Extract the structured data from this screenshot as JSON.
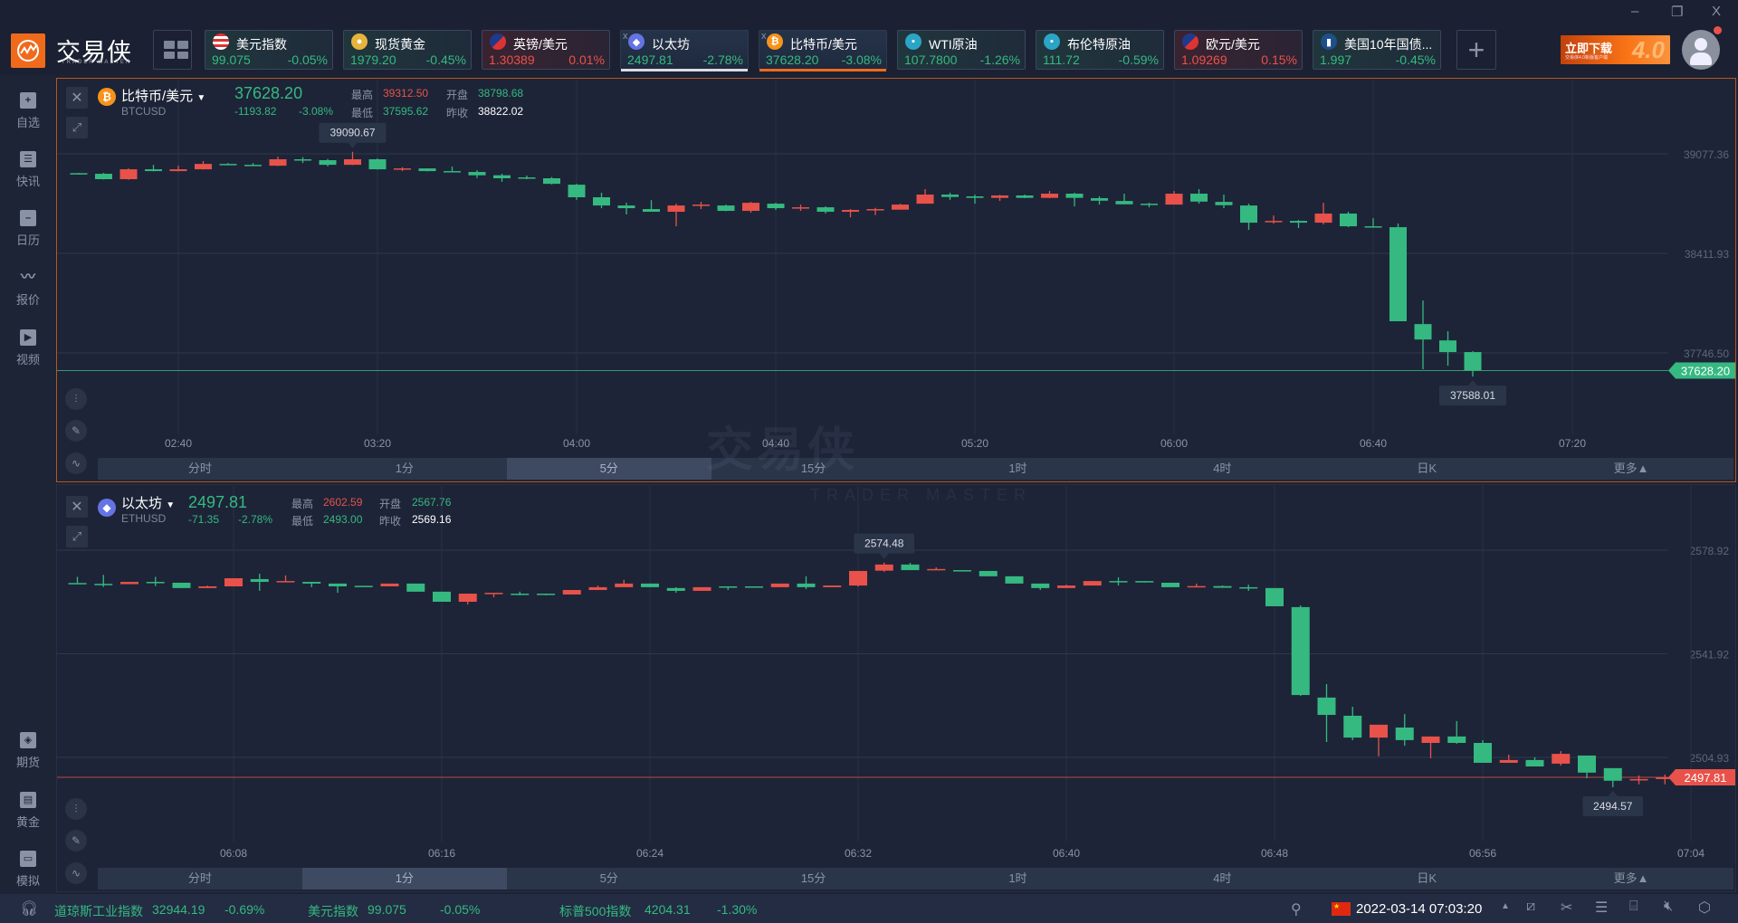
{
  "app": {
    "logo_text": "交易侠",
    "logo_sub": "TRADER MASTER",
    "banner_main": "立即下载",
    "banner_sub": "交易侠4.0新版客户端",
    "banner_version": "4.0",
    "window": {
      "minimize": "–",
      "restore": "❐",
      "close": "X"
    }
  },
  "tickers": [
    {
      "name": "美元指数",
      "price": "99.075",
      "change": "-0.05%",
      "dir": "down",
      "icon": "us-flag-icon"
    },
    {
      "name": "现货黄金",
      "price": "1979.20",
      "change": "-0.45%",
      "dir": "down",
      "icon": "gold-icon"
    },
    {
      "name": "英镑/美元",
      "price": "1.30389",
      "change": "0.01%",
      "dir": "up",
      "icon": "uk-us-flag-icon"
    },
    {
      "name": "以太坊",
      "price": "2497.81",
      "change": "-2.78%",
      "dir": "down",
      "icon": "ethereum-icon",
      "selected": true,
      "underline": "#d7dbe3"
    },
    {
      "name": "比特币/美元",
      "price": "37628.20",
      "change": "-3.08%",
      "dir": "down",
      "icon": "bitcoin-icon",
      "selected": true,
      "underline": "#f06a1c"
    },
    {
      "name": "WTI原油",
      "price": "107.7800",
      "change": "-1.26%",
      "dir": "down",
      "icon": "oil-icon"
    },
    {
      "name": "布伦特原油",
      "price": "111.72",
      "change": "-0.59%",
      "dir": "down",
      "icon": "oil-icon"
    },
    {
      "name": "欧元/美元",
      "price": "1.09269",
      "change": "0.15%",
      "dir": "up",
      "icon": "eu-us-flag-icon"
    },
    {
      "name": "美国10年国债...",
      "price": "1.997",
      "change": "-0.45%",
      "dir": "down",
      "icon": "bond-icon"
    }
  ],
  "sidebar": {
    "top": [
      {
        "label": "自选",
        "icon": "bookmark-icon"
      },
      {
        "label": "快讯",
        "icon": "news-icon"
      },
      {
        "label": "日历",
        "icon": "calendar-icon"
      },
      {
        "label": "报价",
        "icon": "quote-chart-icon"
      },
      {
        "label": "视频",
        "icon": "video-icon"
      }
    ],
    "bottom": [
      {
        "label": "期货",
        "icon": "futures-icon"
      },
      {
        "label": "黄金",
        "icon": "gold-bar-icon"
      },
      {
        "label": "模拟",
        "icon": "wallet-icon"
      }
    ]
  },
  "watermark": {
    "text": "交易侠",
    "sub": "TRADER MASTER"
  },
  "colors": {
    "up": "#e8524a",
    "down": "#35b981",
    "accent": "#f06a1c"
  },
  "panels": [
    {
      "title": "比特币/美元",
      "symbol": "BTCUSD",
      "price": "37628.20",
      "change": "-1193.82",
      "change_pct": "-3.08%",
      "high_label": "最高",
      "high": "39312.50",
      "open_label": "开盘",
      "open": "38798.68",
      "low_label": "最低",
      "low": "37595.62",
      "prev_label": "昨收",
      "prev": "38822.02",
      "tabs": [
        "分时",
        "1分",
        "5分",
        "15分",
        "1时",
        "4时",
        "日K",
        "更多▲"
      ],
      "active_tab": 2
    },
    {
      "title": "以太坊",
      "symbol": "ETHUSD",
      "price": "2497.81",
      "change": "-71.35",
      "change_pct": "-2.78%",
      "high_label": "最高",
      "high": "2602.59",
      "open_label": "开盘",
      "open": "2567.76",
      "low_label": "最低",
      "low": "2493.00",
      "prev_label": "昨收",
      "prev": "2569.16",
      "tabs": [
        "分时",
        "1分",
        "5分",
        "15分",
        "1时",
        "4时",
        "日K",
        "更多▲"
      ],
      "active_tab": 1
    }
  ],
  "chart_data": [
    {
      "type": "candlestick",
      "title": "BTCUSD 5分",
      "interval": "5m",
      "current": "37628.20",
      "current_dir": "down",
      "y_ticks": [
        {
          "value": 39077.36,
          "label": "39077.36"
        },
        {
          "value": 38411.93,
          "label": "38411.93"
        },
        {
          "value": 37746.5,
          "label": "37746.50"
        }
      ],
      "x_ticks": [
        "02:40",
        "03:20",
        "04:00",
        "04:40",
        "05:20",
        "06:00",
        "06:40",
        "07:20"
      ],
      "tooltips": [
        {
          "label": "39090.67",
          "candle": 11,
          "side": "above"
        },
        {
          "label": "37588.01",
          "candle": 56,
          "side": "below"
        }
      ],
      "ohlc": [
        [
          38948,
          38950,
          38946,
          38948
        ],
        [
          38944,
          38950,
          38906,
          38908
        ],
        [
          38908,
          38980,
          38904,
          38974
        ],
        [
          38974,
          39004,
          38960,
          38962
        ],
        [
          38962,
          38998,
          38960,
          38974
        ],
        [
          38974,
          39029,
          38972,
          39010
        ],
        [
          39010,
          39016,
          39002,
          39004
        ],
        [
          39004,
          39016,
          38996,
          38998
        ],
        [
          38998,
          39059,
          38996,
          39041
        ],
        [
          39041,
          39055,
          39016,
          39035
        ],
        [
          39035,
          39043,
          38994,
          39004
        ],
        [
          39004,
          39091,
          39002,
          39041
        ],
        [
          39041,
          39047,
          38972,
          38974
        ],
        [
          38974,
          38988,
          38962,
          38980
        ],
        [
          38980,
          38980,
          38960,
          38962
        ],
        [
          38962,
          38992,
          38956,
          38958
        ],
        [
          38956,
          38968,
          38916,
          38934
        ],
        [
          38934,
          38944,
          38891,
          38914
        ],
        [
          38920,
          38932,
          38908,
          38914
        ],
        [
          38914,
          38922,
          38873,
          38877
        ],
        [
          38871,
          38877,
          38770,
          38787
        ],
        [
          38787,
          38817,
          38714,
          38732
        ],
        [
          38732,
          38750,
          38672,
          38714
        ],
        [
          38708,
          38768,
          38690,
          38690
        ],
        [
          38690,
          38744,
          38593,
          38732
        ],
        [
          38732,
          38756,
          38708,
          38738
        ],
        [
          38732,
          38738,
          38694,
          38696
        ],
        [
          38696,
          38756,
          38684,
          38750
        ],
        [
          38744,
          38750,
          38702,
          38714
        ],
        [
          38714,
          38738,
          38696,
          38720
        ],
        [
          38720,
          38726,
          38678,
          38690
        ],
        [
          38690,
          38708,
          38653,
          38702
        ],
        [
          38706,
          38716,
          38668,
          38708
        ],
        [
          38704,
          38744,
          38704,
          38738
        ],
        [
          38744,
          38841,
          38744,
          38805
        ],
        [
          38805,
          38817,
          38770,
          38789
        ],
        [
          38793,
          38805,
          38744,
          38783
        ],
        [
          38783,
          38803,
          38762,
          38799
        ],
        [
          38799,
          38805,
          38781,
          38783
        ],
        [
          38783,
          38829,
          38781,
          38811
        ],
        [
          38811,
          38817,
          38726,
          38783
        ],
        [
          38781,
          38793,
          38738,
          38764
        ],
        [
          38762,
          38811,
          38740,
          38740
        ],
        [
          38744,
          38750,
          38720,
          38740
        ],
        [
          38738,
          38829,
          38738,
          38811
        ],
        [
          38811,
          38841,
          38744,
          38758
        ],
        [
          38756,
          38805,
          38714,
          38734
        ],
        [
          38732,
          38744,
          38569,
          38617
        ],
        [
          38623,
          38665,
          38611,
          38629
        ],
        [
          38629,
          38635,
          38581,
          38617
        ],
        [
          38617,
          38750,
          38605,
          38678
        ],
        [
          38678,
          38690,
          38587,
          38593
        ],
        [
          38593,
          38647,
          38589,
          38589
        ],
        [
          38587,
          38611,
          37958,
          37958
        ],
        [
          37939,
          38097,
          37637,
          37836
        ],
        [
          37830,
          37891,
          37661,
          37752
        ],
        [
          37752,
          37758,
          37588,
          37628.2
        ]
      ]
    },
    {
      "type": "candlestick",
      "title": "ETHUSD 1分",
      "interval": "1m",
      "current": "2497.81",
      "current_dir": "up",
      "y_ticks": [
        {
          "value": 2578.92,
          "label": "2578.92"
        },
        {
          "value": 2541.92,
          "label": "2541.92"
        },
        {
          "value": 2504.93,
          "label": "2504.93"
        }
      ],
      "x_ticks": [
        "06:08",
        "06:16",
        "06:24",
        "06:32",
        "06:40",
        "06:48",
        "06:56",
        "07:04"
      ],
      "tooltips": [
        {
          "label": "2574.48",
          "candle": 31,
          "side": "above"
        },
        {
          "label": "2494.57",
          "candle": 59,
          "side": "below"
        }
      ],
      "ohlc": [
        [
          2567.2,
          2569.4,
          2567.2,
          2567.2
        ],
        [
          2566.9,
          2570.1,
          2565.8,
          2566.9
        ],
        [
          2566.8,
          2567.6,
          2566.8,
          2567.6
        ],
        [
          2567.6,
          2569.4,
          2566.1,
          2567.5
        ],
        [
          2567.3,
          2567.3,
          2565.4,
          2565.4
        ],
        [
          2565.4,
          2566.3,
          2565.4,
          2566.0
        ],
        [
          2566.0,
          2568.9,
          2566.0,
          2568.9
        ],
        [
          2568.6,
          2570.5,
          2564.4,
          2567.6
        ],
        [
          2567.6,
          2569.9,
          2567.6,
          2567.9
        ],
        [
          2567.6,
          2567.6,
          2565.7,
          2567.0
        ],
        [
          2567.0,
          2567.0,
          2563.7,
          2566.0
        ],
        [
          2566.2,
          2566.2,
          2566.0,
          2566.0
        ],
        [
          2566.0,
          2567.0,
          2566.0,
          2567.0
        ],
        [
          2567.0,
          2567.0,
          2564.1,
          2564.1
        ],
        [
          2564.1,
          2564.1,
          2560.5,
          2560.5
        ],
        [
          2560.5,
          2563.4,
          2559.5,
          2563.4
        ],
        [
          2563.4,
          2563.7,
          2562.1,
          2563.7
        ],
        [
          2563.4,
          2564.1,
          2562.8,
          2563.1
        ],
        [
          2563.4,
          2563.4,
          2562.8,
          2563.1
        ],
        [
          2563.1,
          2564.7,
          2563.1,
          2564.7
        ],
        [
          2564.7,
          2566.3,
          2564.7,
          2565.7
        ],
        [
          2565.7,
          2568.3,
          2565.7,
          2567.0
        ],
        [
          2567.0,
          2567.0,
          2565.7,
          2565.7
        ],
        [
          2565.4,
          2565.7,
          2563.7,
          2564.4
        ],
        [
          2564.4,
          2565.7,
          2564.4,
          2565.7
        ],
        [
          2566.0,
          2566.0,
          2564.7,
          2565.7
        ],
        [
          2566.0,
          2566.0,
          2565.7,
          2565.7
        ],
        [
          2565.7,
          2567.0,
          2565.7,
          2567.0
        ],
        [
          2567.0,
          2569.6,
          2565.0,
          2565.7
        ],
        [
          2565.7,
          2566.3,
          2565.7,
          2566.3
        ],
        [
          2566.3,
          2571.5,
          2565.9,
          2571.5
        ],
        [
          2571.6,
          2574.5,
          2571.2,
          2573.8
        ],
        [
          2573.8,
          2574.4,
          2571.8,
          2571.8
        ],
        [
          2572.0,
          2572.8,
          2572.0,
          2572.2
        ],
        [
          2571.8,
          2571.8,
          2571.3,
          2571.6
        ],
        [
          2571.5,
          2571.5,
          2569.6,
          2569.6
        ],
        [
          2569.6,
          2569.6,
          2567.0,
          2567.0
        ],
        [
          2567.0,
          2567.0,
          2564.7,
          2565.4
        ],
        [
          2565.4,
          2566.6,
          2565.4,
          2566.3
        ],
        [
          2566.3,
          2567.9,
          2566.3,
          2567.9
        ],
        [
          2567.9,
          2569.2,
          2566.3,
          2567.6
        ],
        [
          2567.9,
          2567.9,
          2567.4,
          2567.4
        ],
        [
          2567.3,
          2567.3,
          2565.7,
          2565.7
        ],
        [
          2565.8,
          2567.0,
          2565.8,
          2566.1
        ],
        [
          2566.1,
          2566.3,
          2565.5,
          2565.5
        ],
        [
          2565.7,
          2566.6,
          2564.4,
          2565.5
        ],
        [
          2565.4,
          2565.4,
          2558.9,
          2558.9
        ],
        [
          2558.6,
          2559.2,
          2526.9,
          2527.2
        ],
        [
          2526.3,
          2531.1,
          2510.4,
          2520.1
        ],
        [
          2519.8,
          2523.0,
          2511.1,
          2512.0
        ],
        [
          2512.0,
          2516.6,
          2505.3,
          2516.6
        ],
        [
          2515.6,
          2520.4,
          2509.1,
          2511.1
        ],
        [
          2510.1,
          2512.4,
          2504.6,
          2512.4
        ],
        [
          2512.4,
          2517.9,
          2509.8,
          2510.1
        ],
        [
          2510.1,
          2511.1,
          2503.0,
          2503.0
        ],
        [
          2503.0,
          2505.9,
          2503.0,
          2504.0
        ],
        [
          2504.0,
          2505.0,
          2501.7,
          2501.7
        ],
        [
          2502.7,
          2507.2,
          2502.0,
          2506.2
        ],
        [
          2505.6,
          2505.6,
          2497.5,
          2499.5
        ],
        [
          2501.1,
          2501.1,
          2494.3,
          2496.6
        ],
        [
          2496.7,
          2498.5,
          2495.3,
          2497.2
        ],
        [
          2497.2,
          2498.8,
          2495.3,
          2497.81
        ]
      ]
    }
  ],
  "statusbar": {
    "tickers": [
      {
        "name": "道琼斯工业指数",
        "price": "32944.19",
        "change": "-0.69%"
      },
      {
        "name": "美元指数",
        "price": "99.075",
        "change": "-0.05%"
      },
      {
        "name": "标普500指数",
        "price": "4204.31",
        "change": "-1.30%"
      }
    ],
    "datetime": "2022-03-14 07:03:20",
    "region_flag": "cn-flag-icon"
  }
}
